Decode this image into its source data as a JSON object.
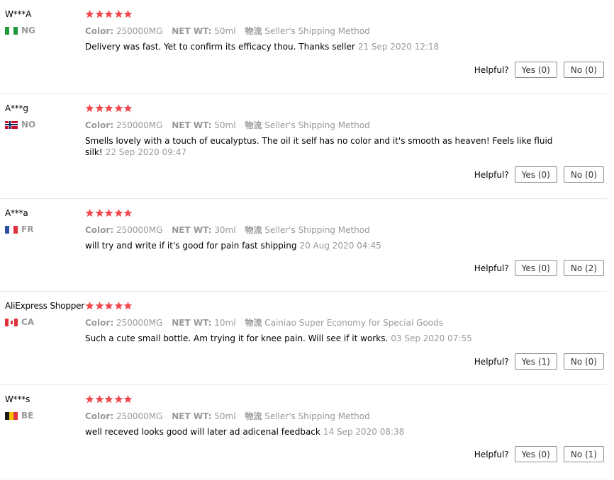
{
  "labels": {
    "color": "Color:",
    "net_wt": "NET WT:",
    "shipping": "物流",
    "helpful": "Helpful?"
  },
  "reviews": [
    {
      "user": "W***A",
      "country": "NG",
      "rating": 5,
      "color": "250000MG",
      "net_wt": "50ml",
      "shipping": "Seller's Shipping Method",
      "text": "Delivery was fast. Yet to confirm its efficacy thou. Thanks seller",
      "date": "21 Sep 2020 12:18",
      "yes": "Yes (0)",
      "no": "No (0)"
    },
    {
      "user": "A***g",
      "country": "NO",
      "rating": 5,
      "color": "250000MG",
      "net_wt": "50ml",
      "shipping": "Seller's Shipping Method",
      "text": "Smells lovely with a touch of eucalyptus. The oil it self has no color and it's smooth as heaven! Feels like fluid silk!",
      "date": "22 Sep 2020 09:47",
      "yes": "Yes (0)",
      "no": "No (0)"
    },
    {
      "user": "A***a",
      "country": "FR",
      "rating": 5,
      "color": "250000MG",
      "net_wt": "30ml",
      "shipping": "Seller's Shipping Method",
      "text": "will try and write if it's good for pain fast shipping",
      "date": "20 Aug 2020 04:45",
      "yes": "Yes (0)",
      "no": "No (2)"
    },
    {
      "user": "AliExpress Shopper",
      "country": "CA",
      "rating": 5,
      "color": "250000MG",
      "net_wt": "10ml",
      "shipping": "Cainiao Super Economy for Special Goods",
      "text": "Such a cute small bottle. Am trying it for knee pain. Will see if it works.",
      "date": "03 Sep 2020 07:55",
      "yes": "Yes (1)",
      "no": "No (0)"
    },
    {
      "user": "W***s",
      "country": "BE",
      "rating": 5,
      "color": "250000MG",
      "net_wt": "50ml",
      "shipping": "Seller's Shipping Method",
      "text": "well receved looks good will later ad adicenal feedback",
      "date": "14 Sep 2020 08:38",
      "yes": "Yes (0)",
      "no": "No (1)"
    }
  ],
  "colors": {
    "star": "#f2474c",
    "muted": "#999999",
    "divider": "#e8e8e8"
  }
}
